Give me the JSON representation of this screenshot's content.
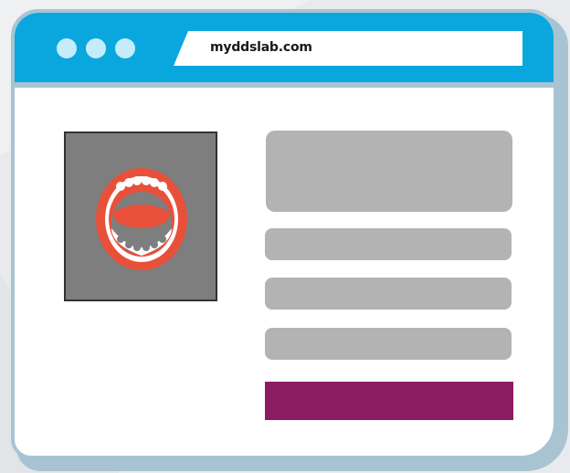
{
  "browser": {
    "url": "myddslab.com",
    "title_bar_color": "#0aa7df",
    "window_dots": [
      "dot-1",
      "dot-2",
      "dot-3"
    ]
  },
  "content": {
    "image_icon": "open-mouth-icon",
    "accent_color": "#8c1c62",
    "placeholder_color": "#b3b3b3"
  }
}
